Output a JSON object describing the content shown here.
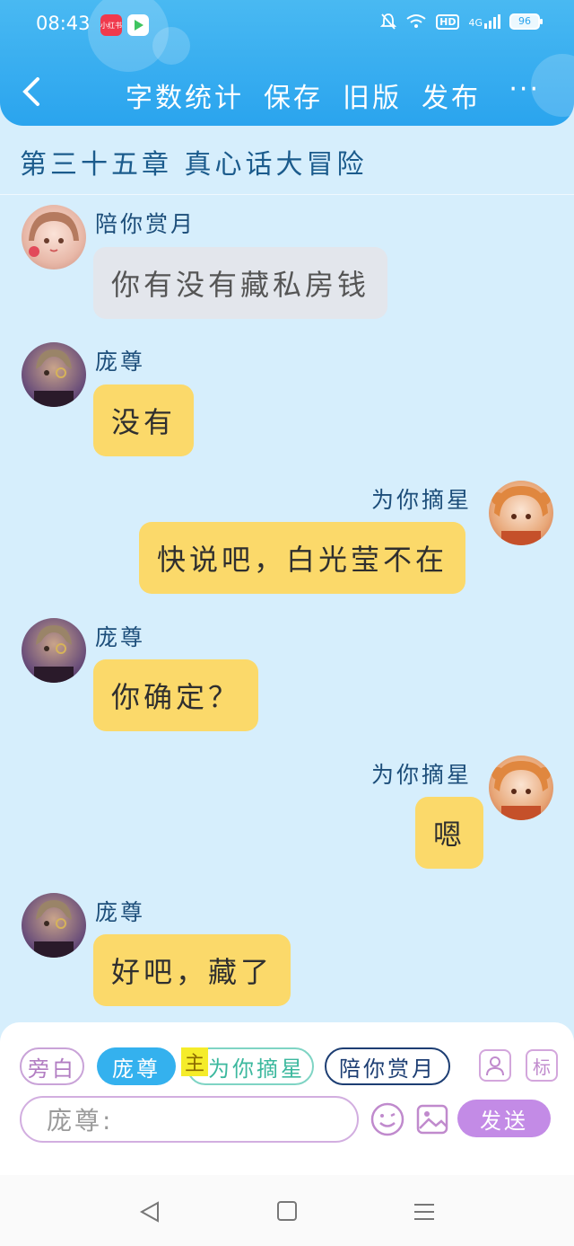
{
  "status_bar": {
    "time": "08:43",
    "app_badge_1": "小红书",
    "network": "4G",
    "hd": "HD",
    "battery": "96"
  },
  "nav": {
    "word_count": "字数统计",
    "save": "保存",
    "old_version": "旧版",
    "publish": "发布",
    "more": "···"
  },
  "chapter_title": "第三十五章  真心话大冒险",
  "messages": [
    {
      "sender": "陪你赏月",
      "text": "你有没有藏私房钱"
    },
    {
      "sender": "庞尊",
      "text": "没有"
    },
    {
      "sender": "为你摘星",
      "text": "快说吧，白光莹不在"
    },
    {
      "sender": "庞尊",
      "text": "你确定？"
    },
    {
      "sender": "为你摘星",
      "text": "嗯"
    },
    {
      "sender": "庞尊",
      "text": "好吧，藏了"
    }
  ],
  "composer": {
    "roles": {
      "narration": "旁白",
      "pang": "庞尊",
      "main_tag": "主",
      "star": "为你摘星",
      "moon": "陪你赏月"
    },
    "input_placeholder": "庞尊:",
    "tag_button": "标",
    "send": "发送"
  },
  "colors": {
    "header": "#2aa4ee",
    "background": "#d6eefc",
    "bubble_yellow": "#fbd96a",
    "bubble_gray": "#e3e6ec",
    "send_button": "#c38be6"
  }
}
